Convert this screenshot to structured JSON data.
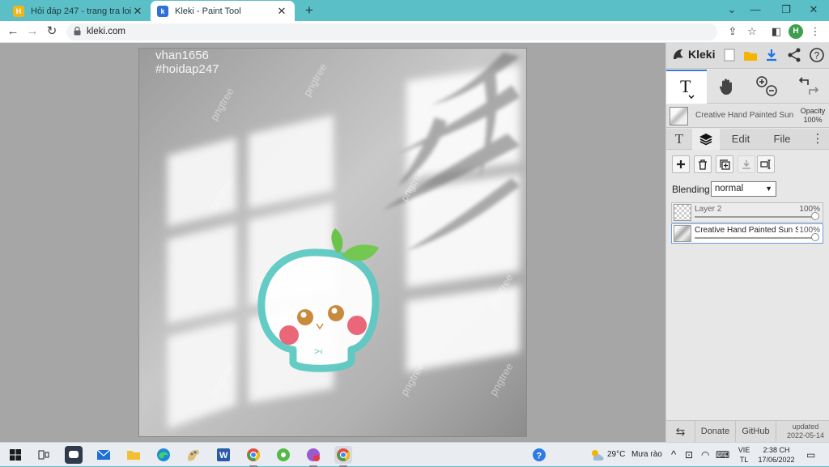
{
  "browser": {
    "tabs": [
      {
        "title": "Hỏi đáp 247 - trang tra loi",
        "active": false
      },
      {
        "title": "Kleki - Paint Tool",
        "active": true
      }
    ],
    "url": "kleki.com",
    "profile_initial": "H"
  },
  "canvas": {
    "watermark_line1": "vhan1656",
    "watermark_line2": "#hoidap247",
    "face_text": ">‹",
    "stock_watermark": "pngtree"
  },
  "panel": {
    "app_name": "Kleki",
    "brush": {
      "name": "Creative Hand Painted Sun",
      "opacity_label": "Opacity",
      "opacity_value": "100%"
    },
    "tabs": {
      "text": "T",
      "edit": "Edit",
      "file": "File"
    },
    "blending_label": "Blending",
    "blending_value": "normal",
    "layers": [
      {
        "name": "Layer 2",
        "opacity": "100%",
        "active": false
      },
      {
        "name": "Creative Hand Painted Sun S",
        "opacity": "100%",
        "active": true
      }
    ],
    "bottom": {
      "donate": "Donate",
      "github": "GitHub",
      "updated_label": "updated",
      "updated_date": "2022-05-14"
    }
  },
  "taskbar": {
    "weather_temp": "29°C",
    "weather_desc": "Mưa rào",
    "lang_line1": "VIE",
    "lang_line2": "TL",
    "time": "2:38 CH",
    "date": "17/06/2022"
  },
  "colors": {
    "chrome_teal": "#5bbfc8",
    "character_teal": "#5ec9c3",
    "blush": "#e8576a",
    "leaf_green": "#6cc34a",
    "active_accent": "#3a7bd5"
  }
}
